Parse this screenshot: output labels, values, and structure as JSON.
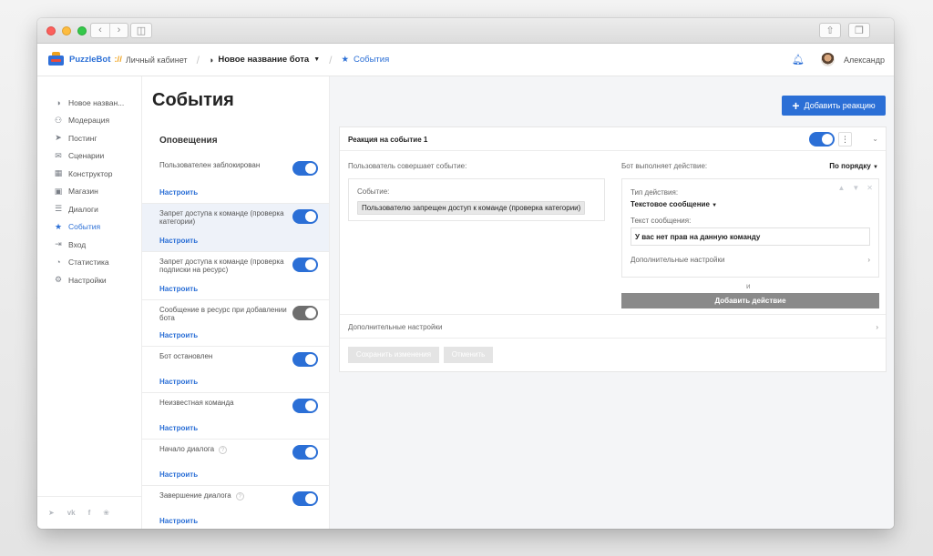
{
  "header": {
    "brand": "PuzzleBot",
    "brand_sep": "://",
    "account": "Личный кабинет",
    "bot_name": "Новое название бота",
    "current": "События",
    "user": "Александр"
  },
  "sidebar": {
    "items": [
      {
        "label": "Новое назван...",
        "icon": "bot-icon"
      },
      {
        "label": "Модерация",
        "icon": "users-icon"
      },
      {
        "label": "Постинг",
        "icon": "send-icon"
      },
      {
        "label": "Сценарии",
        "icon": "chat-icon"
      },
      {
        "label": "Конструктор",
        "icon": "grid-icon"
      },
      {
        "label": "Магазин",
        "icon": "cart-icon"
      },
      {
        "label": "Диалоги",
        "icon": "dialog-icon"
      },
      {
        "label": "События",
        "icon": "star-icon"
      },
      {
        "label": "Вход",
        "icon": "login-icon"
      },
      {
        "label": "Статистика",
        "icon": "chart-icon"
      },
      {
        "label": "Настройки",
        "icon": "gear-icon"
      }
    ],
    "active_index": 7,
    "social": [
      "telegram-icon",
      "vk-icon",
      "facebook-icon",
      "twitter-icon"
    ]
  },
  "events": {
    "page_title": "События",
    "section": "Оповещения",
    "configure": "Настроить",
    "items": [
      {
        "label": "Пользователен заблокирован",
        "on": true
      },
      {
        "label": "Запрет доступа к команде (проверка категории)",
        "on": true,
        "selected": true
      },
      {
        "label": "Запрет доступа к команде (проверка подписки на ресурс)",
        "on": true
      },
      {
        "label": "Сообщение в ресурс при добавлении бота",
        "on": false
      },
      {
        "label": "Бот остановлен",
        "on": true
      },
      {
        "label": "Неизвестная команда",
        "on": true
      },
      {
        "label": "Начало диалога",
        "on": true,
        "help": true
      },
      {
        "label": "Завершение диалога",
        "on": true,
        "help": true
      }
    ]
  },
  "main": {
    "add_reaction": "Добавить реакцию",
    "card_title": "Реакция на событие 1",
    "user_does": "Пользователь совершает событие:",
    "bot_does": "Бот выполняет действие:",
    "order": "По порядку",
    "event_label": "Событие:",
    "event_value": "Пользователю запрещен доступ к команде (проверка категории)",
    "action_type_label": "Тип действия:",
    "action_type": "Текстовое сообщение",
    "message_label": "Текст сообщения:",
    "message_value": "У вас нет прав на данную команду",
    "extra_settings": "Дополнительные настройки",
    "and": "и",
    "add_action": "Добавить действие",
    "card_extra_settings": "Дополнительные настройки",
    "save": "Сохранить изменения",
    "cancel": "Отменить"
  },
  "colors": {
    "accent": "#2b6fd6",
    "toggle_off": "#6e6e6e",
    "add_action_bg": "#8a8a8a"
  }
}
